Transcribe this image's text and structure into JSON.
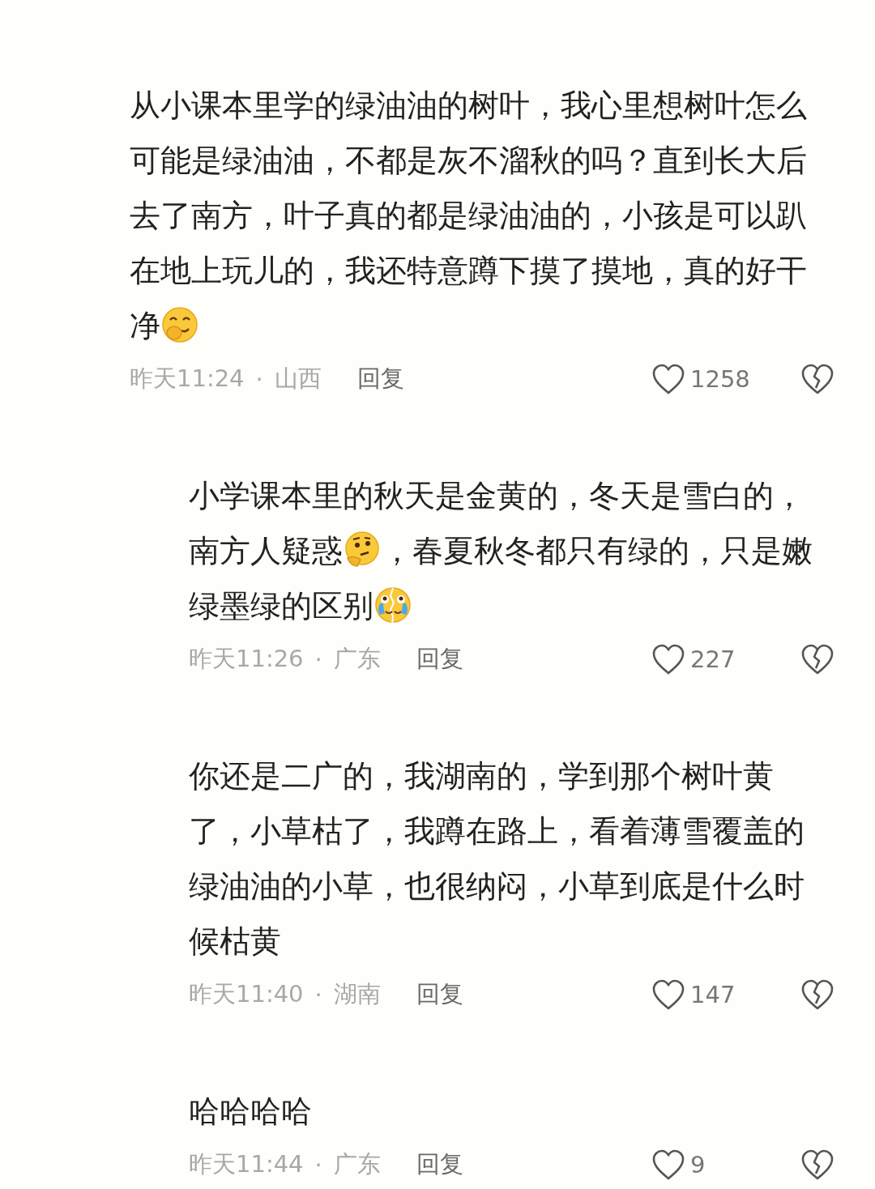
{
  "comments": [
    {
      "indent": false,
      "segments": [
        {
          "kind": "text",
          "text": "从小课本里学的绿油油的树叶，我心里想树叶怎么"
        },
        {
          "kind": "break"
        },
        {
          "kind": "text",
          "text": "可能是绿油油，不都是灰不溜秋的吗？直到长大后"
        },
        {
          "kind": "break"
        },
        {
          "kind": "text",
          "text": "去了南方，叶子真的都是绿油油的，小孩是可以趴"
        },
        {
          "kind": "break"
        },
        {
          "kind": "text",
          "text": "在地上玩儿的，我还特意蹲下摸了摸地，真的好干"
        },
        {
          "kind": "break"
        },
        {
          "kind": "text",
          "text": "净"
        },
        {
          "kind": "smile-emoji"
        }
      ],
      "time": "昨天11:24",
      "separator": "·",
      "location": "山西",
      "reply": "回复",
      "likes": "1258"
    },
    {
      "indent": true,
      "segments": [
        {
          "kind": "text",
          "text": "小学课本里的秋天是金黄的，冬天是雪白的，"
        },
        {
          "kind": "break"
        },
        {
          "kind": "text",
          "text": "南方人疑惑"
        },
        {
          "kind": "thinking-emoji"
        },
        {
          "kind": "text",
          "text": "，春夏秋冬都只有绿的，只是嫩"
        },
        {
          "kind": "break"
        },
        {
          "kind": "text",
          "text": "绿墨绿的区别"
        },
        {
          "kind": "crying-emoji"
        }
      ],
      "time": "昨天11:26",
      "separator": "·",
      "location": "广东",
      "reply": "回复",
      "likes": "227"
    },
    {
      "indent": true,
      "segments": [
        {
          "kind": "text",
          "text": "你还是二广的，我湖南的，学到那个树叶黄"
        },
        {
          "kind": "break"
        },
        {
          "kind": "text",
          "text": "了，小草枯了，我蹲在路上，看着薄雪覆盖的"
        },
        {
          "kind": "break"
        },
        {
          "kind": "text",
          "text": "绿油油的小草，也很纳闷，小草到底是什么时"
        },
        {
          "kind": "break"
        },
        {
          "kind": "text",
          "text": "候枯黄"
        }
      ],
      "time": "昨天11:40",
      "separator": "·",
      "location": "湖南",
      "reply": "回复",
      "likes": "147"
    },
    {
      "indent": true,
      "segments": [
        {
          "kind": "text",
          "text": "哈哈哈哈"
        }
      ],
      "time": "昨天11:44",
      "separator": "·",
      "location": "广东",
      "reply": "回复",
      "likes": "9"
    }
  ]
}
